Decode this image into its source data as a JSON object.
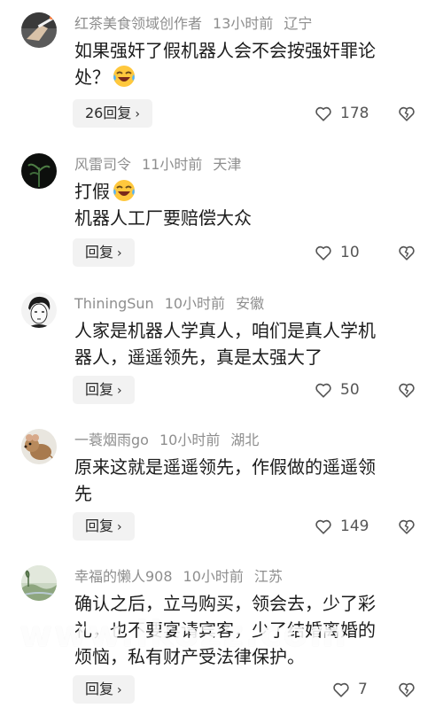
{
  "comments": [
    {
      "user": "红茶美食领域创作者",
      "time": "13小时前",
      "location": "辽宁",
      "text_lines": [
        "如果强奸了假机器人会不会按强奸罪论",
        "处？"
      ],
      "reply_label": "26回复",
      "likes": "178",
      "avatar_icon": "hand-cigarette-avatar",
      "emoji": "laugh-cry-emoji"
    },
    {
      "user": "风雷司令",
      "time": "11小时前",
      "location": "天津",
      "text_lines": [
        "打假",
        "机器人工厂要赔偿大众"
      ],
      "reply_label": "回复",
      "likes": "10",
      "avatar_icon": "dark-plant-avatar",
      "emoji": "laugh-cry-emoji"
    },
    {
      "user": "ThiningSun",
      "time": "10小时前",
      "location": "安徽",
      "text_lines": [
        "人家是机器人学真人，咱们是真人学机",
        "器人，遥遥领先，真是太强大了"
      ],
      "reply_label": "回复",
      "likes": "50",
      "avatar_icon": "sketch-face-avatar"
    },
    {
      "user": "一蓑烟雨go",
      "time": "10小时前",
      "location": "湖北",
      "text_lines": [
        "原来这就是遥遥领先，作假做的遥遥领",
        "先"
      ],
      "reply_label": "回复",
      "likes": "149",
      "avatar_icon": "mouse-avatar"
    },
    {
      "user": "幸福的懒人908",
      "time": "10小时前",
      "location": "江苏",
      "text_lines": [
        "确认之后，立马购买，领会去，少了彩",
        "礼，也不要宴请宾客，少了结婚离婚的",
        "烦恼，私有财产受法律保护。"
      ],
      "reply_label": "回复",
      "likes": "7",
      "avatar_icon": "landscape-avatar"
    }
  ],
  "watermark": "www.lkozz.com",
  "colors": {
    "background": "#ffffff",
    "meta_text": "#8e8e8e",
    "body_text": "#1c1c1c",
    "reply_bg": "#f2f2f2"
  }
}
